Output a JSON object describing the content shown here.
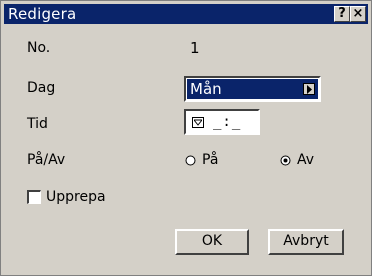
{
  "window": {
    "title": "Redigera",
    "help_icon": "?",
    "close_icon": "×"
  },
  "form": {
    "no_label": "No.",
    "no_value": "1",
    "day_label": "Dag",
    "day_value": "Mån",
    "time_label": "Tid",
    "time_value": "_:_",
    "onoff_label": "På/Av",
    "on_label": "På",
    "off_label": "Av",
    "selected_state": "Av",
    "repeat_label": "Upprepa",
    "repeat_checked": false
  },
  "buttons": {
    "ok_label": "OK",
    "cancel_label": "Avbryt"
  },
  "colors": {
    "title_bar": "#0a246a",
    "dialog_bg": "#d4d0c8",
    "highlight": "#0a246a"
  }
}
